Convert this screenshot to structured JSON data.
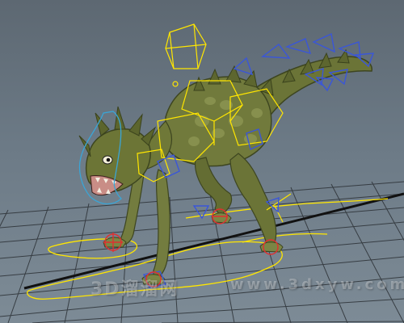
{
  "viewport": {
    "name": "maya-perspective-viewport",
    "background_top": "#5d6872",
    "background_bottom": "#7d8b96"
  },
  "scene": {
    "subject": "lizard-creature-rigged-model",
    "skin_color": "#6f7a3a",
    "rig_curve_colors": {
      "ik_controls": "#ffe600",
      "spine_controls": "#3a56d8",
      "head_control": "#3aa5d6",
      "foot_locators": "#e03030"
    },
    "grid_color": "#2c3136"
  },
  "watermark": {
    "left_text": "3D溜溜网",
    "right_text": "www.3dxyw.com"
  }
}
